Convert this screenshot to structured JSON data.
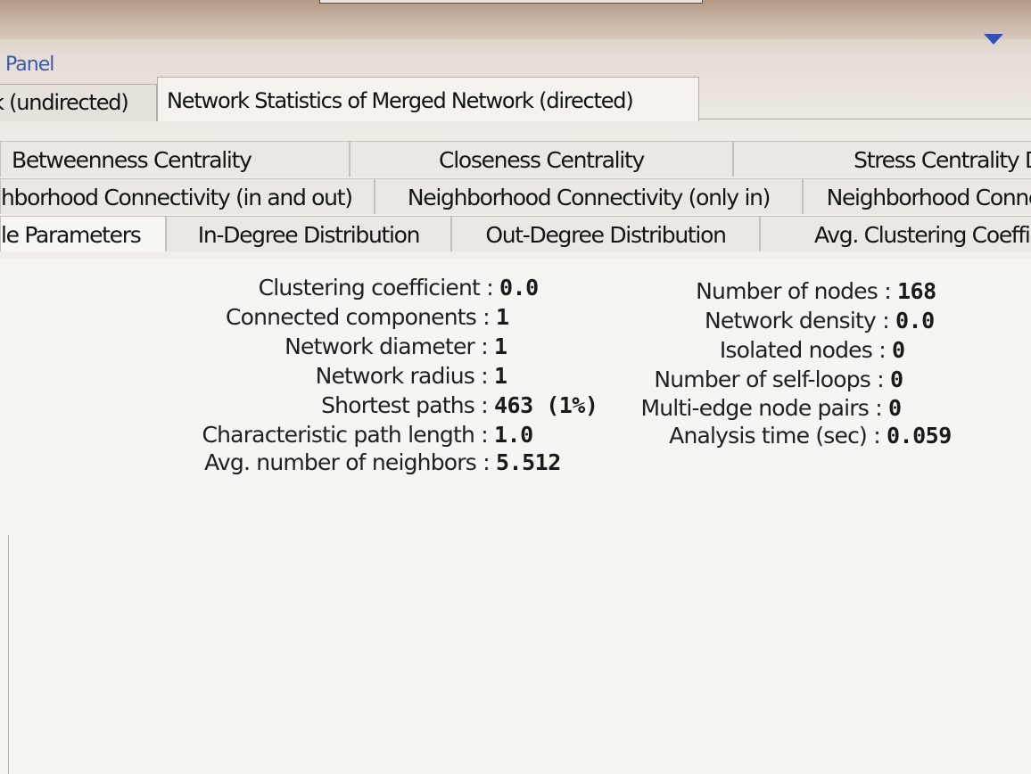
{
  "panel": {
    "title": "Panel"
  },
  "outer_tabs": [
    {
      "label": "k (undirected)"
    },
    {
      "label": "Network Statistics of Merged Network (directed)"
    }
  ],
  "inner_tabs": {
    "row1": [
      {
        "label": "Betweenness Centrality"
      },
      {
        "label": "Closeness Centrality"
      },
      {
        "label": "Stress Centrality D"
      }
    ],
    "row2": [
      {
        "label": "hborhood Connectivity (in and out)"
      },
      {
        "label": "Neighborhood Connectivity (only in)"
      },
      {
        "label": "Neighborhood Conne"
      }
    ],
    "row3": [
      {
        "label": "le Parameters"
      },
      {
        "label": "In-Degree Distribution"
      },
      {
        "label": "Out-Degree Distribution"
      },
      {
        "label": "Avg. Clustering Coeffic"
      }
    ]
  },
  "stats_left": [
    {
      "label": "Clustering coefficient",
      "value": "0.0"
    },
    {
      "label": "Connected components",
      "value": "1"
    },
    {
      "label": "Network diameter",
      "value": "1"
    },
    {
      "label": "Network radius",
      "value": "1"
    },
    {
      "label": "Shortest paths",
      "value": "463 (1%)"
    },
    {
      "label": "Characteristic path length",
      "value": "1.0"
    },
    {
      "label": "Avg. number of neighbors",
      "value": "5.512"
    }
  ],
  "stats_right": [
    {
      "label": "Number of nodes",
      "value": "168"
    },
    {
      "label": "Network density",
      "value": "0.0"
    },
    {
      "label": "Isolated nodes",
      "value": "0"
    },
    {
      "label": "Number of self-loops",
      "value": "0"
    },
    {
      "label": "Multi-edge node pairs",
      "value": "0"
    },
    {
      "label": "Analysis time (sec)",
      "value": "0.059"
    }
  ],
  "separator": ":",
  "colors": {
    "panel_title": "#3f58a8",
    "dropdown_arrow": "#3252b8"
  },
  "icons": {
    "dropdown": "triangle-down-icon"
  }
}
